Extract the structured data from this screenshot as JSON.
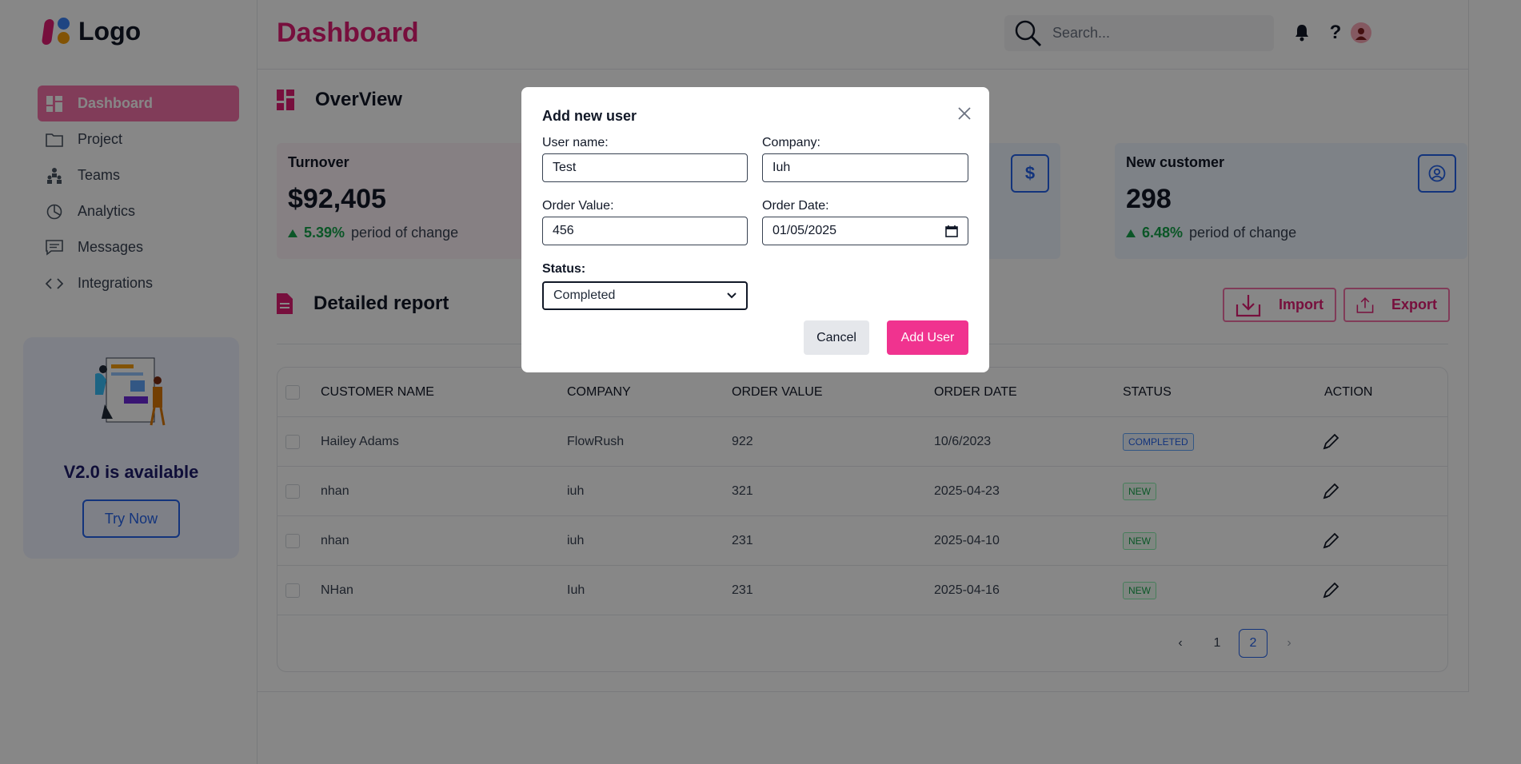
{
  "logo": {
    "text": "Logo"
  },
  "sidebar": {
    "items": [
      {
        "label": "Dashboard",
        "icon": "dashboard-icon"
      },
      {
        "label": "Project",
        "icon": "folder-icon"
      },
      {
        "label": "Teams",
        "icon": "teams-icon"
      },
      {
        "label": "Analytics",
        "icon": "pie-chart-icon"
      },
      {
        "label": "Messages",
        "icon": "message-icon"
      },
      {
        "label": "Integrations",
        "icon": "code-icon"
      }
    ]
  },
  "promo": {
    "title": "V2.0 is available",
    "button": "Try Now"
  },
  "header": {
    "title": "Dashboard",
    "search_placeholder": "Search...",
    "icons": [
      "bell-icon",
      "help-icon",
      "avatar"
    ]
  },
  "overview": {
    "title": "OverView",
    "cards": [
      {
        "label": "Turnover",
        "value": "$92,405",
        "change": "5.39%",
        "change_text": "period of change",
        "icon": "dollar-icon"
      },
      {
        "label": "New customer",
        "value": "298",
        "change": "6.48%",
        "change_text": "period of change",
        "icon": "user-circle-icon"
      }
    ],
    "hidden_card_icon_text": "$"
  },
  "report": {
    "title": "Detailed report",
    "import_label": "Import",
    "export_label": "Export",
    "columns": [
      "CUSTOMER NAME",
      "COMPANY",
      "ORDER VALUE",
      "ORDER DATE",
      "STATUS",
      "ACTION"
    ],
    "rows": [
      {
        "name": "Hailey Adams",
        "company": "FlowRush",
        "value": "922",
        "date": "10/6/2023",
        "status": "COMPLETED"
      },
      {
        "name": "nhan",
        "company": "iuh",
        "value": "321",
        "date": "2025-04-23",
        "status": "NEW"
      },
      {
        "name": "nhan",
        "company": "iuh",
        "value": "231",
        "date": "2025-04-10",
        "status": "NEW"
      },
      {
        "name": "NHan",
        "company": "Iuh",
        "value": "231",
        "date": "2025-04-16",
        "status": "NEW"
      }
    ],
    "pagination": {
      "prev": "‹",
      "pages": [
        "1",
        "2"
      ],
      "current": "2",
      "next": "›"
    }
  },
  "modal": {
    "title": "Add new user",
    "username_label": "User name:",
    "username_value": "Test",
    "company_label": "Company:",
    "company_value": "Iuh",
    "order_value_label": "Order Value:",
    "order_value_value": "456",
    "order_date_label": "Order Date:",
    "order_date_value": "01/05/2025",
    "status_label": "Status:",
    "status_value": "Completed",
    "cancel_label": "Cancel",
    "add_label": "Add User"
  },
  "colors": {
    "brand": "#e11d74",
    "accent_blue": "#2563eb",
    "positive": "#16a34a",
    "add_button": "#f0338f"
  }
}
